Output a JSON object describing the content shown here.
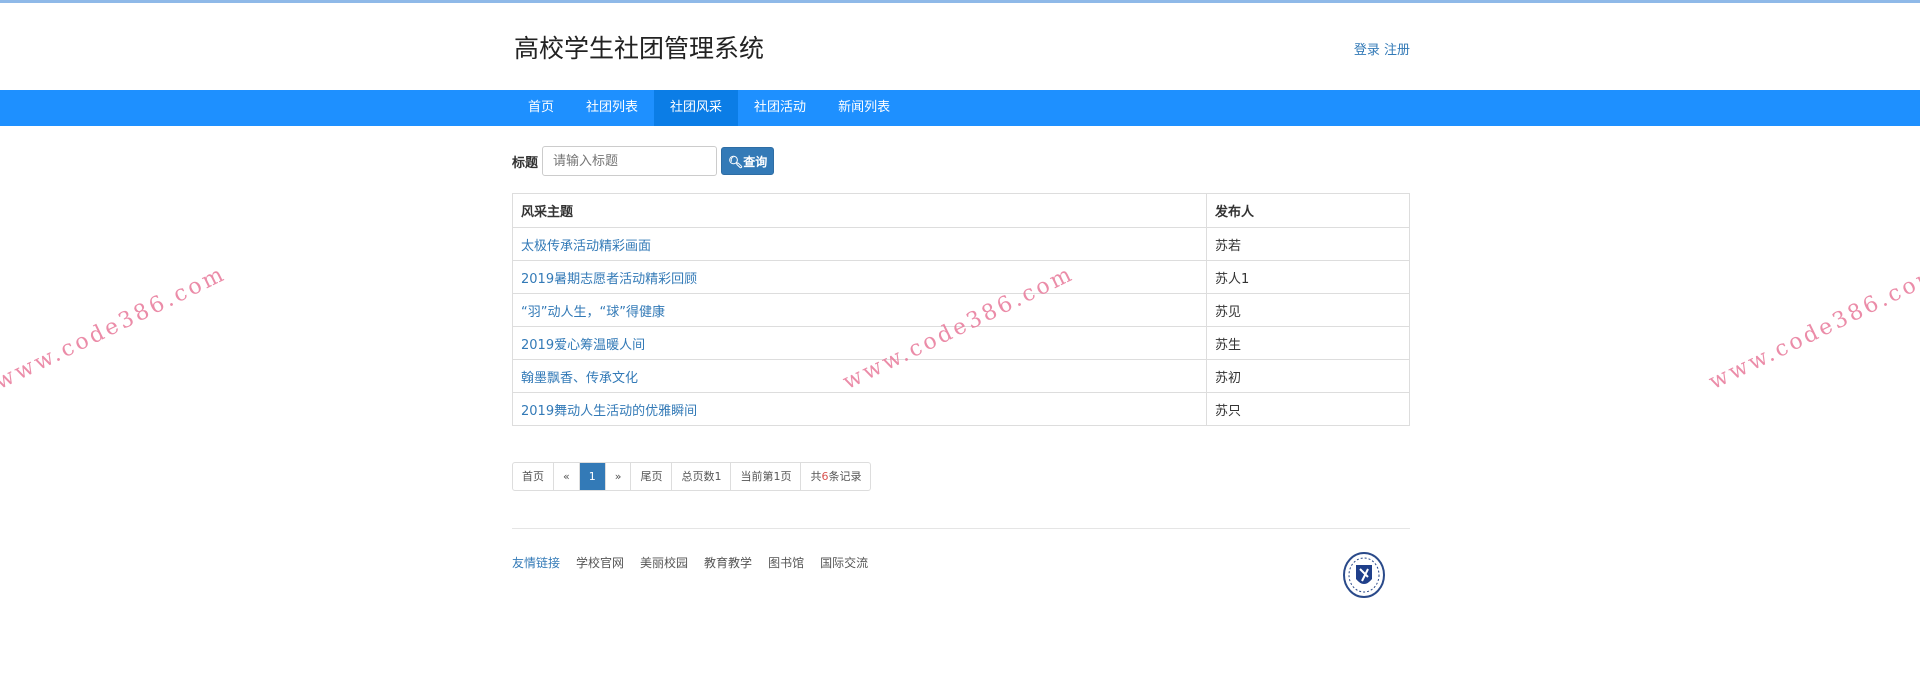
{
  "header": {
    "title": "高校学生社团管理系统",
    "login": "登录",
    "register": "注册"
  },
  "nav": [
    {
      "label": "首页"
    },
    {
      "label": "社团列表"
    },
    {
      "label": "社团风采",
      "active": true
    },
    {
      "label": "社团活动"
    },
    {
      "label": "新闻列表"
    }
  ],
  "search": {
    "label": "标题",
    "placeholder": "请输入标题",
    "button": "查询",
    "icon": "search-icon"
  },
  "table": {
    "headers": [
      "风采主题",
      "发布人"
    ],
    "rows": [
      [
        "太极传承活动精彩画面",
        "苏若"
      ],
      [
        "2019暑期志愿者活动精彩回顾",
        "苏人1"
      ],
      [
        "“羽”动人生，“球”得健康",
        "苏见"
      ],
      [
        "2019爱心筹温暖人间",
        "苏生"
      ],
      [
        "翰墨飘香、传承文化",
        "苏初"
      ],
      [
        "2019舞动人生活动的优雅瞬间",
        "苏只"
      ]
    ]
  },
  "pager": {
    "first": "首页",
    "prev": "«",
    "current": "1",
    "next": "»",
    "last": "尾页",
    "total_pages": "总页数1",
    "current_page": "当前第1页",
    "records_prefix": "共",
    "records_count": "6",
    "records_suffix": "条记录"
  },
  "footer": {
    "links": [
      "友情链接",
      "学校官网",
      "美丽校园",
      "教育教学",
      "图书馆",
      "国际交流"
    ]
  },
  "watermark": "www.code386.com",
  "colors": {
    "nav": "#1e90ff",
    "nav_active": "#0b7de6",
    "link": "#337ab7",
    "watermark": "#e8789a"
  }
}
